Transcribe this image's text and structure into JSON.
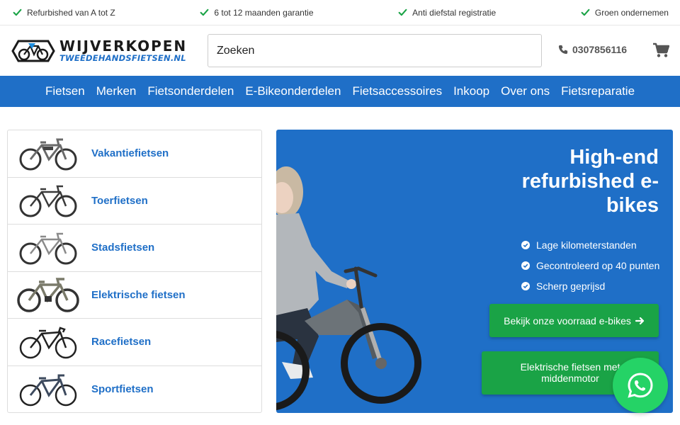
{
  "usps": [
    {
      "label": "Refurbished van A tot Z",
      "icon": "check-icon"
    },
    {
      "label": "6 tot 12 maanden garantie",
      "icon": "check-icon"
    },
    {
      "label": "Anti diefstal registratie",
      "icon": "check-icon"
    },
    {
      "label": "Groen ondernemen",
      "icon": "check-icon"
    }
  ],
  "header": {
    "logo_line1": "WIJVERKOPEN",
    "logo_line2": "TWEEDEHANDSFIETSEN.NL",
    "search_value": "Zoeken",
    "phone": "0307856116",
    "phone_icon": "phone-icon",
    "cart_icon": "cart-icon"
  },
  "nav": [
    "Fietsen",
    "Merken",
    "Fietsonderdelen",
    "E-Bikeonderdelen",
    "Fietsaccessoires",
    "Inkoop",
    "Over ons",
    "Fietsreparatie"
  ],
  "categories": [
    "Vakantiefietsen",
    "Toerfietsen",
    "Stadsfietsen",
    "Elektrische fietsen",
    "Racefietsen",
    "Sportfietsen"
  ],
  "hero": {
    "title": "High-end refurbished e-bikes",
    "bullets": [
      "Lage kilometerstanden",
      "Gecontroleerd op 40 punten",
      "Scherp geprijsd"
    ],
    "button1": "Bekijk onze voorraad e-bikes",
    "button2": "Elektrische fietsen met middenmotor"
  },
  "colors": {
    "brand_blue": "#1f6fc7",
    "button_green": "#1aa346",
    "whatsapp_green": "#25d366",
    "check_green": "#1aa346"
  }
}
